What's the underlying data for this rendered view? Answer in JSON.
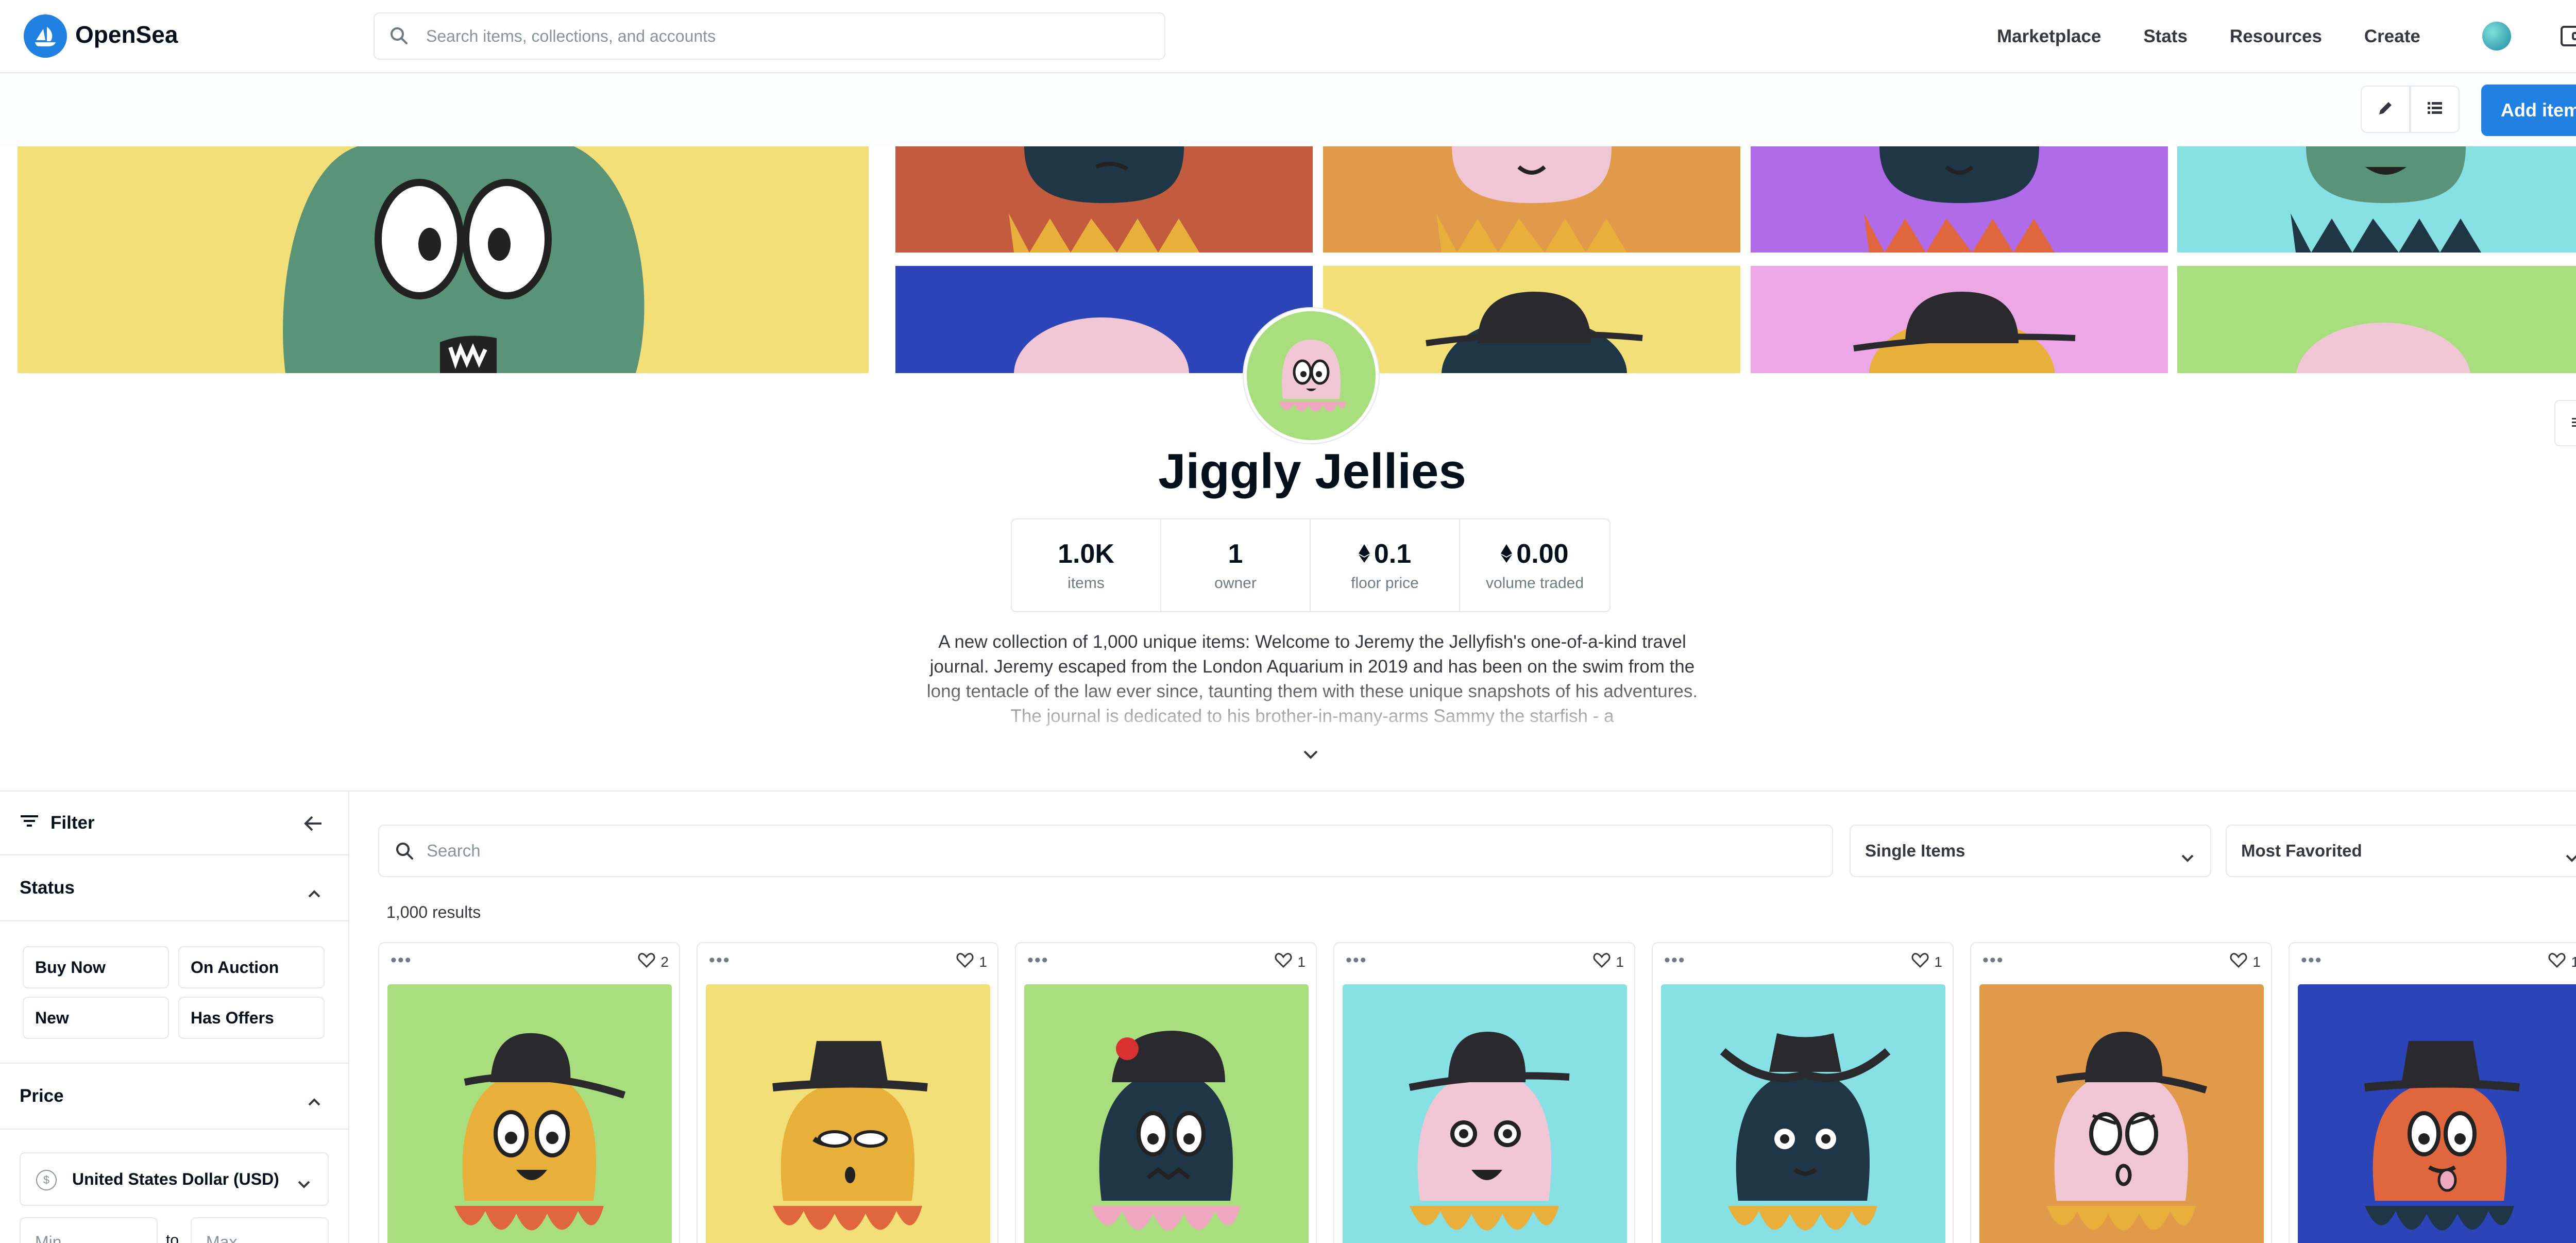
{
  "header": {
    "brand": "OpenSea",
    "search_placeholder": "Search items, collections, and accounts",
    "nav": [
      "Marketplace",
      "Stats",
      "Resources",
      "Create"
    ]
  },
  "actions": {
    "add_item": "Add item"
  },
  "collection": {
    "name": "Jiggly Jellies",
    "stats": [
      {
        "value": "1.0K",
        "label": "items",
        "eth": false
      },
      {
        "value": "1",
        "label": "owner",
        "eth": false
      },
      {
        "value": "0.1",
        "label": "floor price",
        "eth": true
      },
      {
        "value": "0.00",
        "label": "volume traded",
        "eth": true
      }
    ],
    "description": "A new collection of 1,000 unique items: Welcome to Jeremy the Jellyfish's one-of-a-kind travel journal. Jeremy escaped from the London Aquarium in 2019 and has been on the swim from the long tentacle of the law ever since, taunting them with these unique snapshots of his adventures. The journal is dedicated to his brother-in-many-arms Sammy the starfish - a"
  },
  "filter": {
    "title": "Filter",
    "status": {
      "title": "Status",
      "options": [
        "Buy Now",
        "On Auction",
        "New",
        "Has Offers"
      ]
    },
    "price": {
      "title": "Price",
      "currency": "United States Dollar (USD)",
      "currency_symbol": "$",
      "min_placeholder": "Min",
      "max_placeholder": "Max",
      "to": "to"
    }
  },
  "grid": {
    "search_placeholder": "Search",
    "item_type": "Single Items",
    "sort": "Most Favorited",
    "results": "1,000 results",
    "items": [
      {
        "likes": "2",
        "bg": "#a9de7e"
      },
      {
        "likes": "1",
        "bg": "#f3df78"
      },
      {
        "likes": "1",
        "bg": "#a9de7e"
      },
      {
        "likes": "1",
        "bg": "#86e0e4"
      },
      {
        "likes": "1",
        "bg": "#86e0e4"
      },
      {
        "likes": "1",
        "bg": "#e09a4a"
      },
      {
        "likes": "1",
        "bg": "#2b45b8"
      }
    ]
  },
  "colors": {
    "accent": "#2081e2",
    "border": "#e5e8eb",
    "text": "#04111d"
  }
}
